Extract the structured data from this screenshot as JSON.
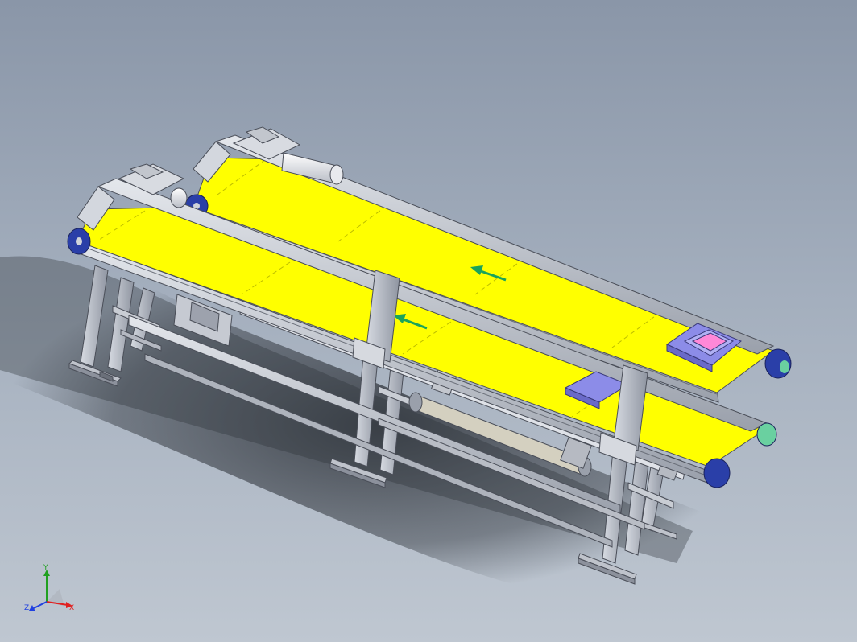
{
  "viewport": {
    "background_top": "#8a96a8",
    "background_bottom": "#bfc7d1"
  },
  "model": {
    "description_type": "3D CAD assembly view",
    "belt_color": "#ffff00",
    "frame_color": "#c8ccd4",
    "frame_edge_color": "#4a4e58",
    "pulley_color": "#2a3fa8",
    "motor_color": "#e6e8ee",
    "fixture_color": "#8c8ce8",
    "fixture_accent": "#ff88d8",
    "arrow_color": "#1aa35a",
    "conveyors": [
      {
        "name": "back-conveyor",
        "direction_icon": "arrow-left-icon"
      },
      {
        "name": "front-conveyor",
        "direction_icon": "arrow-left-icon"
      }
    ]
  },
  "triad": {
    "x_label": "X",
    "y_label": "Y",
    "z_label": "Z",
    "x_color": "#e02020",
    "y_color": "#20a020",
    "z_color": "#2040e0"
  }
}
